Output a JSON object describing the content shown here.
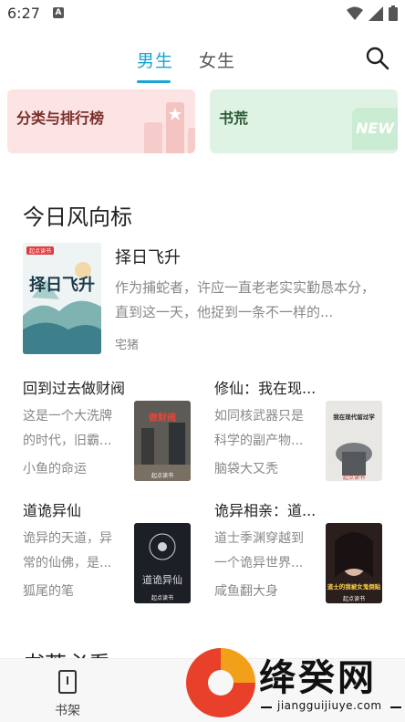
{
  "status": {
    "time": "6:27",
    "a_glyph": "A"
  },
  "tabs": [
    {
      "label": "男生",
      "active": true
    },
    {
      "label": "女生",
      "active": false
    }
  ],
  "cards": {
    "left_label": "分类与排行榜",
    "right_label": "书荒",
    "right_badge": "NEW"
  },
  "section": {
    "title": "今日风向标",
    "next_title": "书荒必看"
  },
  "featured": {
    "title": "择日飞升",
    "desc": "作为捕蛇者，许应一直老老实实勤恳本分，直到这一天，他捉到一条不一样的...",
    "author": "宅猪",
    "cover_text": "择日飞升",
    "cover_brand": "起点读书"
  },
  "books": [
    {
      "title": "回到过去做财阀",
      "desc": "这是一个大洗牌的时代，旧霸...",
      "author": "小鱼的命运",
      "cover_text": "做财阀",
      "cover_brand": "起点读书"
    },
    {
      "title": "修仙：我在现...",
      "desc": "如同核武器只是科学的副产物...",
      "author": "脑袋大又秃",
      "cover_text": "我在现代留过学",
      "cover_brand": "起点读书"
    },
    {
      "title": "道诡异仙",
      "desc": "诡异的天道，异常的仙佛，是...",
      "author": "狐尾的笔",
      "cover_text": "道诡异仙",
      "cover_brand": "起点读书"
    },
    {
      "title": "诡异相亲：道...",
      "desc": "道士季渊穿越到一个诡异世界...",
      "author": "咸鱼翻大身",
      "cover_text": "道士的我被女鬼倒贴",
      "cover_brand": "起点读书"
    }
  ],
  "bottom_nav": {
    "shelf_label": "书架"
  },
  "watermark": {
    "text": "绛癸网",
    "url": "jiangguijiuye.com"
  },
  "colors": {
    "accent": "#1aa3d5",
    "card_pink": "#fbe4e3",
    "card_green": "#dff3e4"
  }
}
